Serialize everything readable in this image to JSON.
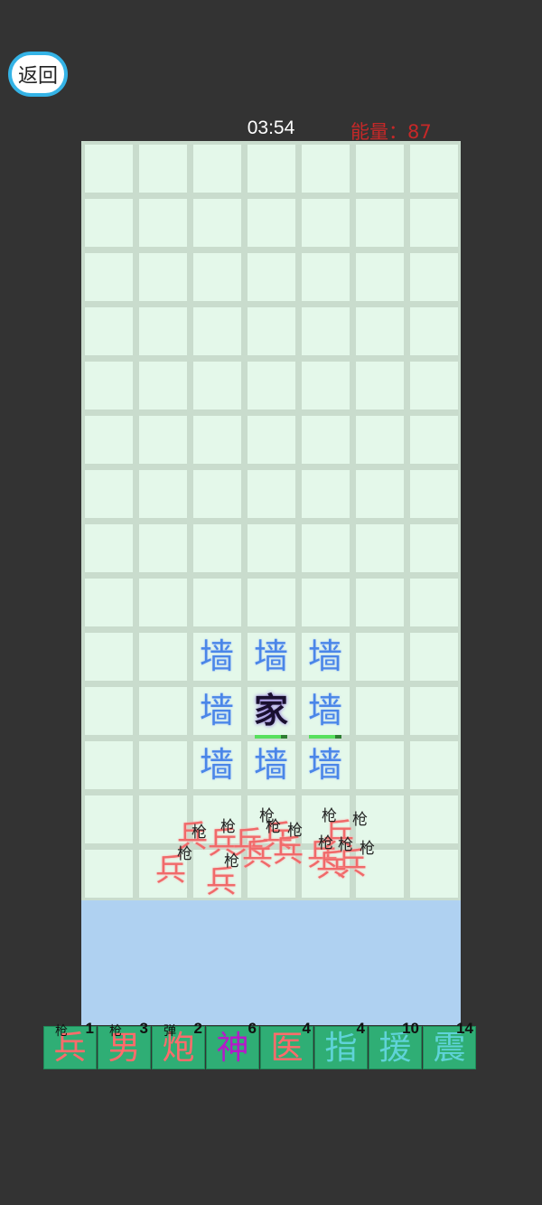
{
  "back_label": "返回",
  "timer": "03:54",
  "energy_label": "能量：",
  "energy_value": "87",
  "board": {
    "cols": 7,
    "rows": 14,
    "walls": [
      {
        "label": "墙",
        "col": 2,
        "row": 9
      },
      {
        "label": "墙",
        "col": 3,
        "row": 9
      },
      {
        "label": "墙",
        "col": 4,
        "row": 9
      },
      {
        "label": "墙",
        "col": 2,
        "row": 10
      },
      {
        "label": "墙",
        "col": 4,
        "row": 10
      },
      {
        "label": "墙",
        "col": 2,
        "row": 11
      },
      {
        "label": "墙",
        "col": 3,
        "row": 11
      },
      {
        "label": "墙",
        "col": 4,
        "row": 11
      }
    ],
    "home": {
      "label": "家",
      "col": 3,
      "row": 10
    },
    "health_bars": [
      {
        "col": 3,
        "row": 10,
        "fill": 0.8
      },
      {
        "col": 4,
        "row": 10,
        "fill": 0.8
      }
    ],
    "soldier_label": "兵",
    "gun_label": "枪"
  },
  "cards": [
    {
      "glyph": "兵",
      "cost": "1",
      "sub": "枪",
      "color": "#ff6b6b"
    },
    {
      "glyph": "男",
      "cost": "3",
      "sub": "枪",
      "color": "#ff6b6b"
    },
    {
      "glyph": "炮",
      "cost": "2",
      "sub": "弹",
      "color": "#ff6b6b"
    },
    {
      "glyph": "神",
      "cost": "6",
      "sub": "",
      "color": "#b519c9"
    },
    {
      "glyph": "医",
      "cost": "4",
      "sub": "",
      "color": "#ff6b6b"
    },
    {
      "glyph": "指",
      "cost": "4",
      "sub": "",
      "color": "#5fd3d8"
    },
    {
      "glyph": "援",
      "cost": "10",
      "sub": "",
      "color": "#5fd3d8"
    },
    {
      "glyph": "震",
      "cost": "14",
      "sub": "",
      "color": "#5fd3d8"
    }
  ]
}
